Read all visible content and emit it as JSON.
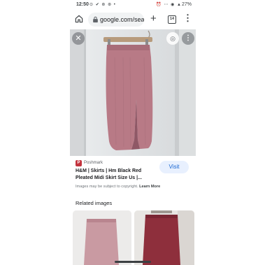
{
  "status_bar": {
    "time": "12:50",
    "left_icons": "⊙ ✔ ⊛ ⊛ •",
    "right_icons": "⏰ ⋯ ◉ ▲",
    "battery": "27%"
  },
  "browser": {
    "url": "google.com/sea",
    "tab_count": "14",
    "home_icon": "home-icon",
    "lock_icon": "lock-icon",
    "new_tab_icon": "plus-icon",
    "menu_icon": "vertical-dots-icon"
  },
  "image_viewer": {
    "close_icon": "close-icon",
    "lens_icon": "lens-icon",
    "more_icon": "vertical-dots-icon"
  },
  "result": {
    "source_name": "Poshmark",
    "title": "H&M | Skirts | Hm Black Red Pleated Midi Skirt Size Us |...",
    "visit_label": "Visit",
    "copyright_text": "Images may be subject to copyright.",
    "learn_more_label": "Learn More"
  },
  "related": {
    "heading": "Related images"
  },
  "colors": {
    "skirt_pink": "#b87a86",
    "visit_bg": "#e8f0fe",
    "visit_text": "#1967d2",
    "source_favicon": "#c3333d",
    "skirt_red": "#8e2f3c"
  }
}
